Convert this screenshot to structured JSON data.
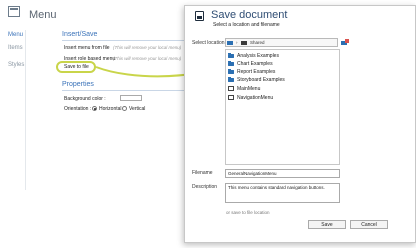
{
  "app": {
    "title": "Menu"
  },
  "nav": {
    "items": [
      "Menu",
      "Items",
      "Styles"
    ]
  },
  "insert_save": {
    "heading": "Insert/Save",
    "rows": [
      {
        "label": "Insert menu from file",
        "note": "(This will remove your local menu)"
      },
      {
        "label": "Insert role based menu",
        "note": "(This will remove your local menu)"
      },
      {
        "label": "Save to file",
        "note": ""
      }
    ]
  },
  "properties": {
    "heading": "Properties",
    "background_label": "Background color :",
    "orientation_label": "Orientation :",
    "orientation_options": [
      "Horizontal",
      "Vertical"
    ],
    "orientation_selected": "Horizontal"
  },
  "dialog": {
    "title": "Save document",
    "subtitle": "Select a location and filename",
    "select_location_label": "Select location",
    "path": "Shared",
    "items": [
      {
        "name": "Analysis Examples",
        "type": "folder"
      },
      {
        "name": "Chart Examples",
        "type": "folder"
      },
      {
        "name": "Report Examples",
        "type": "folder"
      },
      {
        "name": "Storyboard Examples",
        "type": "folder"
      },
      {
        "name": "MainMenu",
        "type": "file"
      },
      {
        "name": "NavigationMenu",
        "type": "file"
      }
    ],
    "filename_label": "Filename",
    "filename_value": "GeneralNavigationMenu",
    "description_label": "Description",
    "description_value": "This menu contains standard navigation buttons.",
    "or_save_link": "or save to file location",
    "save_button": "Save",
    "cancel_button": "Cancel"
  },
  "colors": {
    "accent": "#3b73b9",
    "highlight": "#c9d54a",
    "folder": "#2b6fb2"
  }
}
